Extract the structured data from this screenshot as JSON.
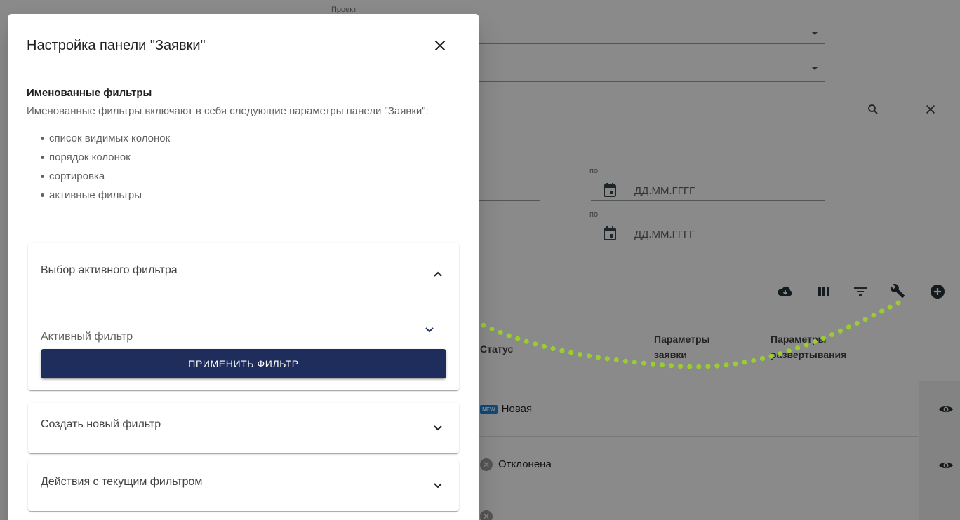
{
  "dialog": {
    "title": "Настройка панели \"Заявки\"",
    "section_title": "Именованные фильтры",
    "section_description": "Именованные фильтры включают в себя следующие параметры панели \"Заявки\":",
    "bullets": [
      "список видимых колонок",
      "порядок колонок",
      "сортировка",
      "активные фильтры"
    ],
    "panels": [
      {
        "title": "Выбор активного фильтра",
        "expanded": true,
        "select_label": "Активный фильтр",
        "button_label": "ПРИМЕНИТЬ ФИЛЬТР"
      },
      {
        "title": "Создать новый фильтр",
        "expanded": false
      },
      {
        "title": "Действия с текущим фильтром",
        "expanded": false
      }
    ]
  },
  "background": {
    "project_label": "Проект",
    "date_to_label": "по",
    "date_placeholder": "ДД.ММ.ГГГГ",
    "columns": {
      "status": "Статус",
      "request_params": "Параметры заявки",
      "deploy_params": "Параметры развертывания"
    },
    "rows": [
      {
        "status": "Новая",
        "badge": "NEW"
      },
      {
        "status": "Отклонена"
      }
    ],
    "toolbar_icons": [
      "cloud-download-icon",
      "columns-icon",
      "filter-icon",
      "wrench-icon",
      "add-circle-icon"
    ]
  },
  "colors": {
    "primary_button": "#1f2d5c",
    "annotation": "#9acd32",
    "scrim": "rgba(0,0,0,0.46)"
  }
}
